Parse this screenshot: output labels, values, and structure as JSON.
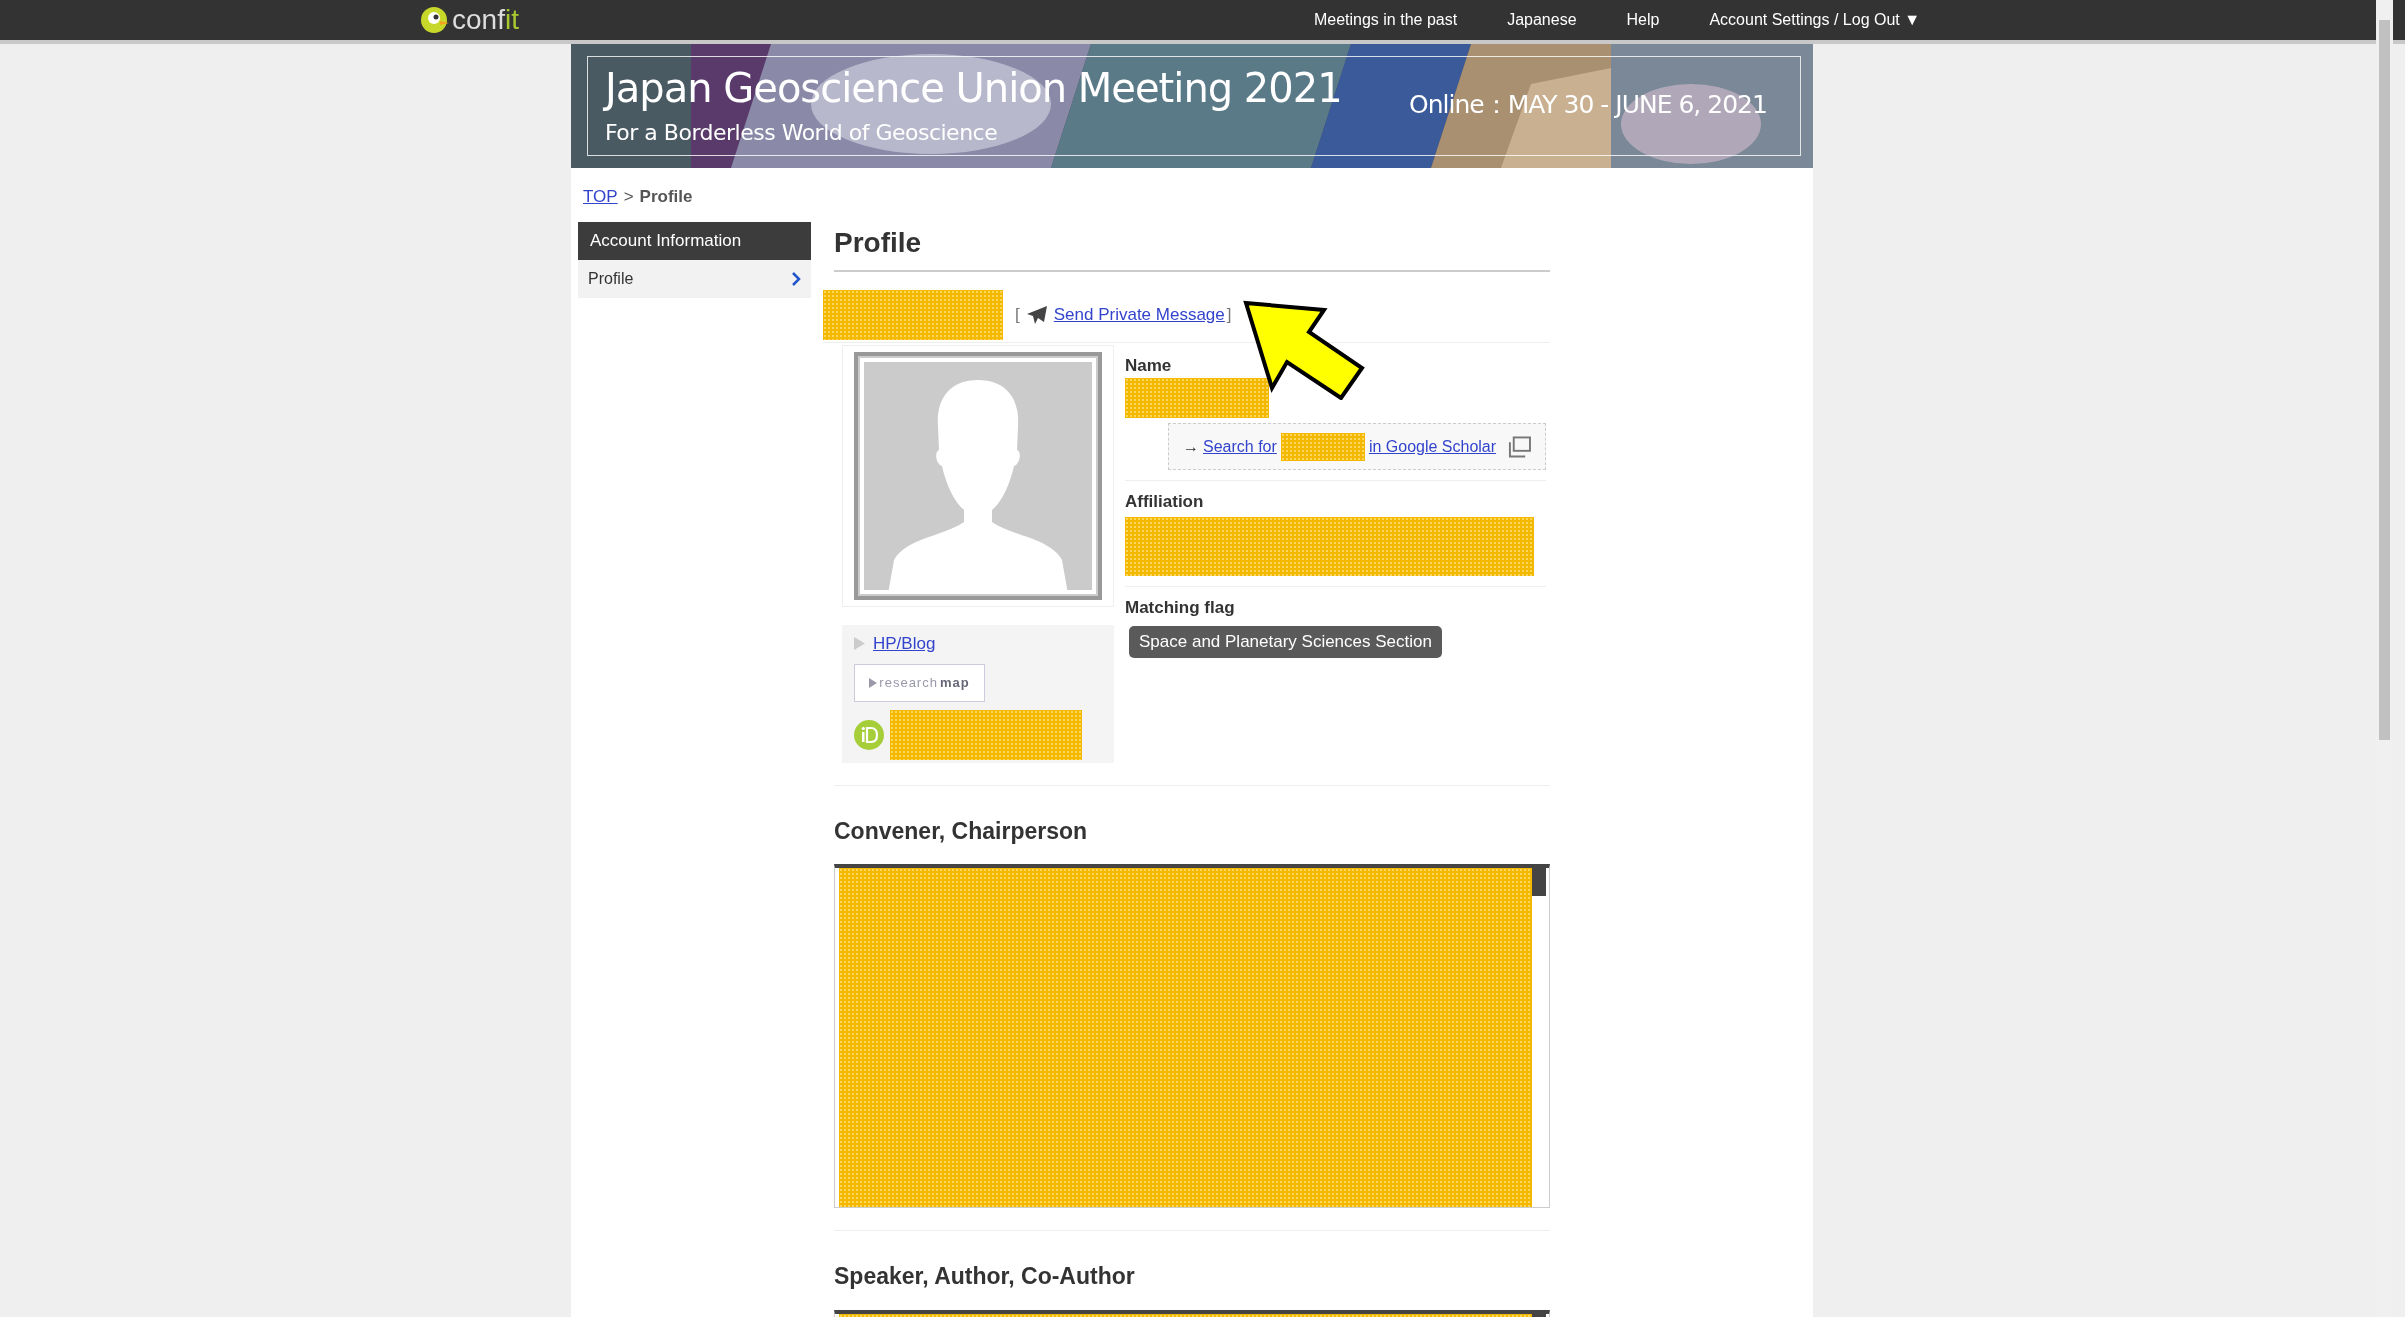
{
  "top_bar": {
    "logo": {
      "main": "conf",
      "accent": "it"
    },
    "nav": [
      "Meetings in the past",
      "Japanese",
      "Help",
      "Account Settings / Log Out ▼"
    ]
  },
  "banner": {
    "kind": "picture",
    "title": "Japan Geoscience Union Meeting 2021",
    "subtitle": "For a Borderless World of Geoscience",
    "dates": "Online：MAY 30 - JUNE 6, 2021"
  },
  "breadcrumb": [
    {
      "label": "TOP",
      "kind": "link"
    },
    {
      "label": ">",
      "kind": "separator"
    },
    {
      "label": "Profile",
      "kind": "current"
    }
  ],
  "sidebar": {
    "header": "Account Information",
    "items": [
      {
        "label": "Profile",
        "selected": true
      }
    ]
  },
  "profile": {
    "title": "Profile",
    "message_link": {
      "open": "[",
      "label": "Send Private Message",
      "close": "]"
    },
    "links": {
      "hp": "HP/Blog",
      "researchmap": {
        "light": "research",
        "bold": "map"
      }
    },
    "fields": [
      {
        "kind": "name",
        "label": "Name",
        "scholar": {
          "arrow": "→",
          "before": "Search for",
          "after": "in Google Scholar"
        }
      },
      {
        "kind": "affiliation",
        "label": "Affiliation"
      },
      {
        "kind": "flag",
        "label": "Matching flag",
        "badge": "Space and Planetary Sciences Section"
      }
    ]
  },
  "sections": [
    {
      "title": "Convener, Chairperson"
    },
    {
      "title": "Speaker, Author, Co-Author"
    }
  ]
}
